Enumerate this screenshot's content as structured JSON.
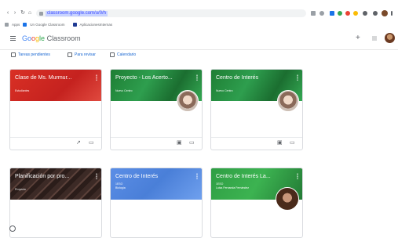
{
  "browser": {
    "url": "classroom.google.com/u/0/h",
    "bookmarks": [
      "Apps",
      "Un Google Classroom",
      "AplicacionesInternas"
    ],
    "extension_colors": [
      "#5f6368",
      "#5f6368",
      "#1a73e8",
      "#34a853",
      "#ea4335",
      "#fbbc05",
      "#5f6368"
    ]
  },
  "header": {
    "brand_g1": "Go",
    "brand_g2": "o",
    "brand_g3": "g",
    "brand_g4": "le",
    "brand_suffix": " Classroom",
    "add_label": "+"
  },
  "subbar": {
    "items": [
      {
        "label": "Tareas pendientes",
        "icon": "assignment-icon"
      },
      {
        "label": "Para revisar",
        "icon": "review-icon"
      },
      {
        "label": "Calendario",
        "icon": "calendar-icon"
      }
    ]
  },
  "cards": [
    {
      "title": "Clase de Ms. Murmur...",
      "subtitle": "Estudiantes",
      "subtitle2": "",
      "theme": "red",
      "has_avatar": false,
      "foot_icons": [
        "trending-icon",
        "folder-icon"
      ]
    },
    {
      "title": "Proyecto - Los Acerto...",
      "subtitle": "Nuevo Centro",
      "subtitle2": "",
      "theme": "green",
      "has_avatar": true,
      "foot_icons": [
        "assignment-icon",
        "folder-icon"
      ]
    },
    {
      "title": "Centro de Interés",
      "subtitle": "Nuevo Centro",
      "subtitle2": "",
      "theme": "green",
      "has_avatar": true,
      "foot_icons": [
        "assignment-icon",
        "folder-icon"
      ]
    },
    {
      "title": "Planificación por pro...",
      "subtitle": "Proyecto",
      "subtitle2": "",
      "theme": "dark",
      "has_avatar": false,
      "foot_icons": []
    },
    {
      "title": "Centro de Interés",
      "subtitle": "1ESO",
      "subtitle2": "Biología",
      "theme": "blue",
      "has_avatar": false,
      "foot_icons": []
    },
    {
      "title": "Centro de Interés La...",
      "subtitle": "1ESO",
      "subtitle2": "Luisa Fernanda Fernández",
      "theme": "green2",
      "has_avatar": true,
      "foot_icons": []
    }
  ]
}
